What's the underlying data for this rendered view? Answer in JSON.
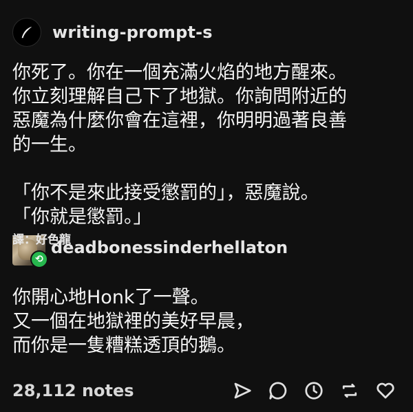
{
  "post": {
    "author": "writing-prompt-s",
    "body": "你死了。你在一個充滿火焰的地方醒來。\n你立刻理解自己下了地獄。你詢問附近的\n惡魔為什麼你會在這裡，你明明過著良善\n的一生。\n\n「你不是來此接受懲罰的」，惡魔說。\n「你就是懲罰。」"
  },
  "reblog": {
    "translator": "譯：好色龍",
    "author": "deadbonessinderhellaton",
    "body": "你開心地Honk了一聲。\n又一個在地獄裡的美好早晨，\n而你是一隻糟糕透頂的鵝。",
    "badge_icon": "reblog-icon"
  },
  "footer": {
    "notes": "28,112 notes",
    "icons": [
      "share-icon",
      "reply-icon",
      "history-icon",
      "reblog-icon",
      "like-heart-icon"
    ]
  }
}
